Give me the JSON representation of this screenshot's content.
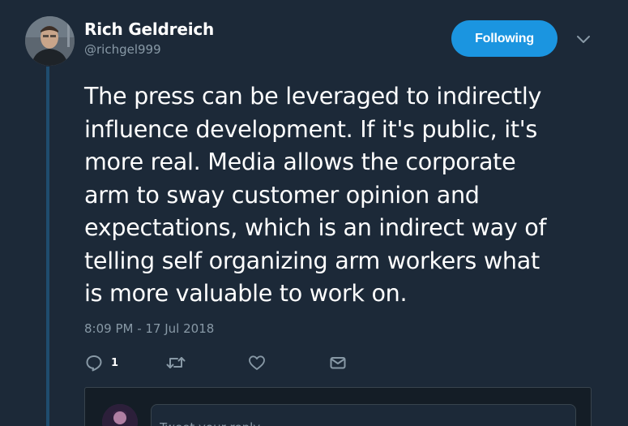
{
  "author": {
    "display_name": "Rich Geldreich",
    "handle": "@richgel999"
  },
  "follow_button": {
    "label": "Following"
  },
  "tweet": {
    "text": "The press can be leveraged to indirectly\ninfluence development. If it's public, it's\nmore real. Media allows the corporate\narm to sway customer opinion and\nexpectations, which is an indirect way of\ntelling self organizing arm workers what\nis more valuable to work on.",
    "timestamp": "8:09 PM - 17 Jul 2018"
  },
  "actions": {
    "reply_count": "1",
    "icons": [
      "reply-icon",
      "retweet-icon",
      "like-icon",
      "direct-message-icon"
    ]
  },
  "reply_box": {
    "placeholder": "Tweet your reply"
  },
  "colors": {
    "background": "#1c2938",
    "accent": "#1b95e0",
    "secondary_text": "#8899a6",
    "thread_line": "#1f4c6e"
  }
}
